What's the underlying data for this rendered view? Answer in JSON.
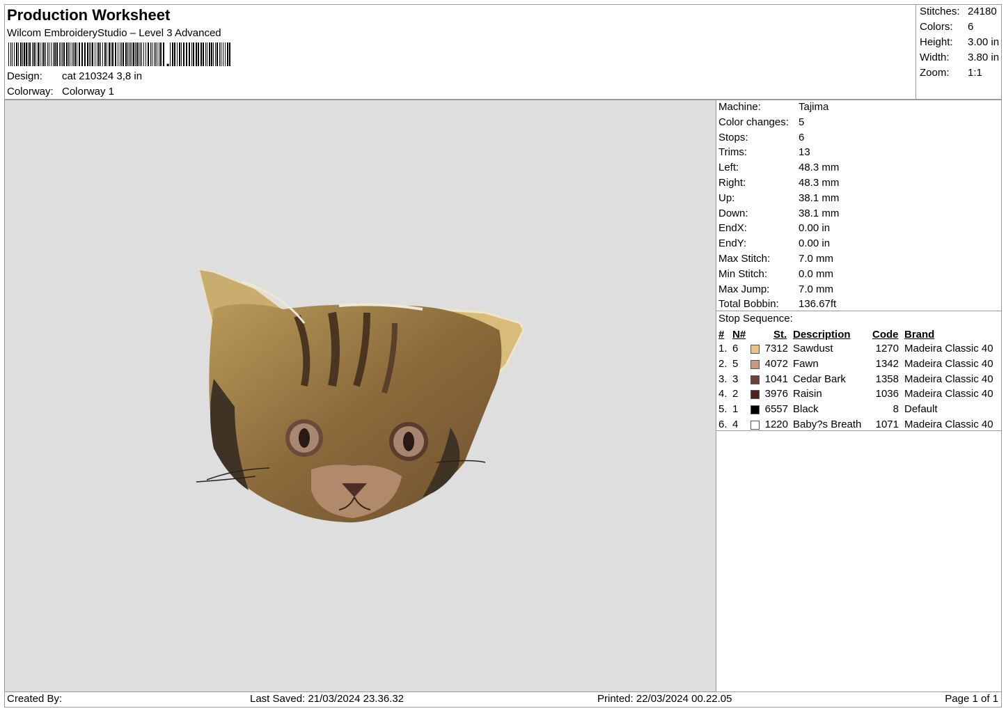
{
  "header": {
    "title": "Production Worksheet",
    "software": "Wilcom EmbroideryStudio – Level 3 Advanced",
    "design_label": "Design:",
    "design_value": "cat 210324 3,8 in",
    "colorway_label": "Colorway:",
    "colorway_value": "Colorway 1"
  },
  "summary": {
    "stitches_label": "Stitches:",
    "stitches_value": "24180",
    "colors_label": "Colors:",
    "colors_value": "6",
    "height_label": "Height:",
    "height_value": "3.00 in",
    "width_label": "Width:",
    "width_value": "3.80 in",
    "zoom_label": "Zoom:",
    "zoom_value": "1:1"
  },
  "details": [
    {
      "label": "Machine:",
      "value": "Tajima"
    },
    {
      "label": "Color changes:",
      "value": "5"
    },
    {
      "label": "Stops:",
      "value": "6"
    },
    {
      "label": "Trims:",
      "value": "13"
    },
    {
      "label": "Left:",
      "value": "48.3 mm"
    },
    {
      "label": "Right:",
      "value": "48.3 mm"
    },
    {
      "label": "Up:",
      "value": "38.1 mm"
    },
    {
      "label": "Down:",
      "value": "38.1 mm"
    },
    {
      "label": "EndX:",
      "value": "0.00 in"
    },
    {
      "label": "EndY:",
      "value": "0.00 in"
    },
    {
      "label": "Max Stitch:",
      "value": "7.0 mm"
    },
    {
      "label": "Min Stitch:",
      "value": "0.0 mm"
    },
    {
      "label": "Max Jump:",
      "value": "7.0 mm"
    },
    {
      "label": "Total Bobbin:",
      "value": "136.67ft"
    }
  ],
  "stop_sequence": {
    "title": "Stop Sequence:",
    "headers": {
      "num": "#",
      "n_num": "N#",
      "st": "St.",
      "description": "Description",
      "code": "Code",
      "brand": "Brand"
    },
    "rows": [
      {
        "num": "1.",
        "n": "6",
        "color": "#e6c483",
        "st": "7312",
        "description": "Sawdust",
        "code": "1270",
        "brand": "Madeira Classic 40"
      },
      {
        "num": "2.",
        "n": "5",
        "color": "#c59a7f",
        "st": "4072",
        "description": "Fawn",
        "code": "1342",
        "brand": "Madeira Classic 40"
      },
      {
        "num": "3.",
        "n": "3",
        "color": "#6b4336",
        "st": "1041",
        "description": "Cedar Bark",
        "code": "1358",
        "brand": "Madeira Classic 40"
      },
      {
        "num": "4.",
        "n": "2",
        "color": "#4e2119",
        "st": "3976",
        "description": "Raisin",
        "code": "1036",
        "brand": "Madeira Classic 40"
      },
      {
        "num": "5.",
        "n": "1",
        "color": "#000000",
        "st": "6557",
        "description": "Black",
        "code": "8",
        "brand": "Default"
      },
      {
        "num": "6.",
        "n": "4",
        "color": "#ffffff",
        "st": "1220",
        "description": "Baby?s Breath",
        "code": "1071",
        "brand": "Madeira Classic 40"
      }
    ]
  },
  "footer": {
    "created_by": "Created By:",
    "last_saved": "Last Saved: 21/03/2024 23.36.32",
    "printed": "Printed: 22/03/2024 00.22.05",
    "page": "Page 1 of 1"
  },
  "colors": {
    "preview_bg": "#dedede",
    "border": "#999999"
  }
}
